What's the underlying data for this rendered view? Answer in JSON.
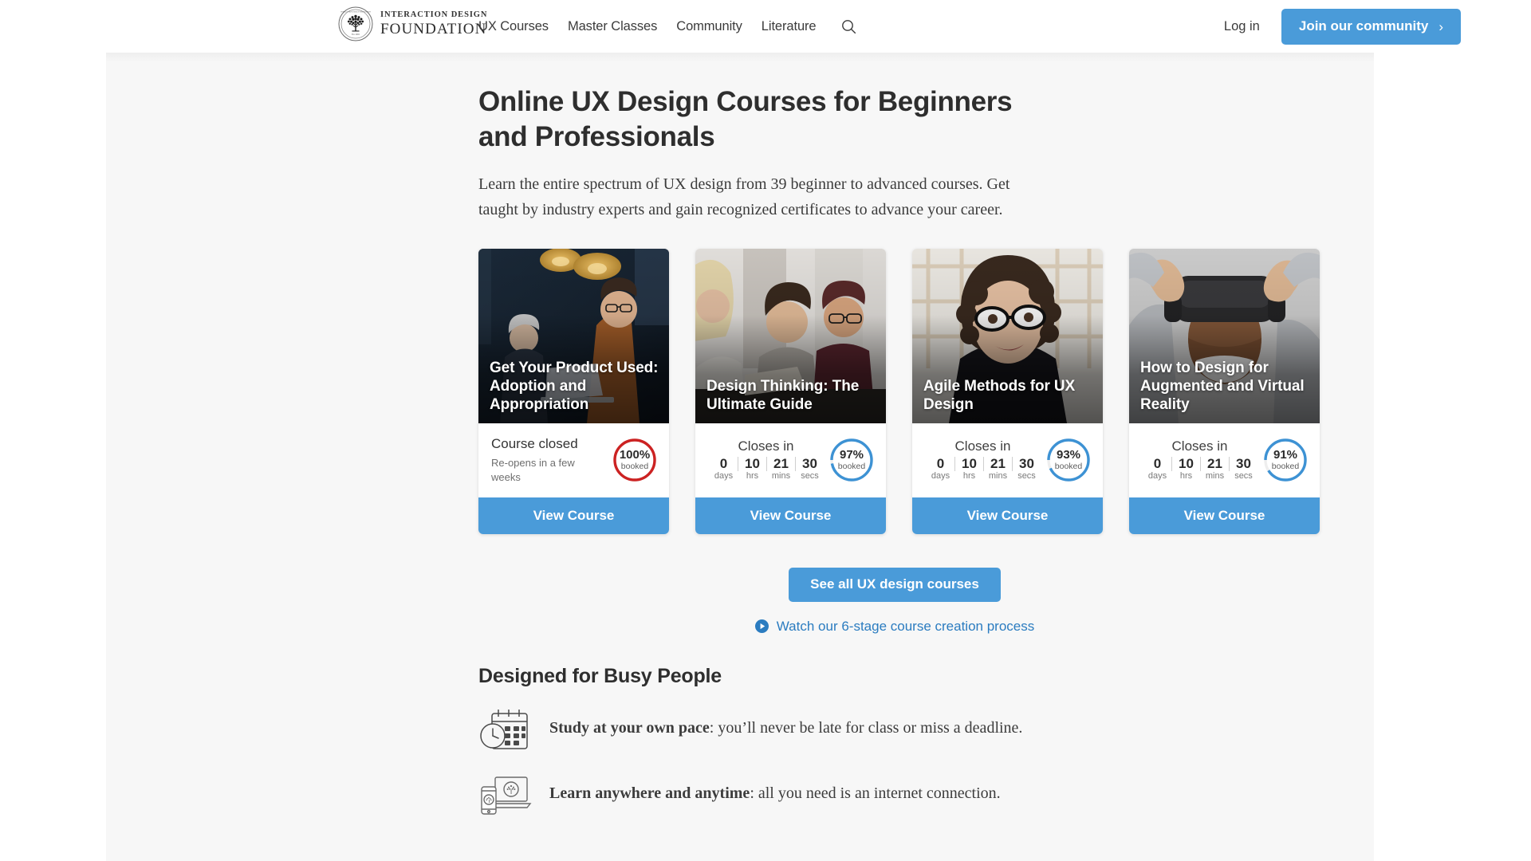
{
  "brand": {
    "line1": "INTERACTION DESIGN",
    "line2": "FOUNDATION",
    "seal_text": "Est. 2002"
  },
  "nav": {
    "items": [
      {
        "label": "UX Courses"
      },
      {
        "label": "Master Classes"
      },
      {
        "label": "Community"
      },
      {
        "label": "Literature"
      }
    ],
    "search_icon": "search-icon",
    "login_label": "Log in",
    "join_label": "Join our community",
    "join_chevron": "›"
  },
  "hero": {
    "title": "Online UX Design Courses for Beginners and Professionals",
    "subtitle": "Learn the entire spectrum of UX design from 39 beginner to advanced courses. Get taught by industry experts and gain recognized certificates to advance your career."
  },
  "cards": [
    {
      "title": "Get Your Product Used: Adoption and Appropriation",
      "state": "closed",
      "closed_head": "Course closed",
      "closed_sub": "Re-opens in a few weeks",
      "percent": 100,
      "percent_label": "100%",
      "booked_label": "booked",
      "ring_color": "#cc2222",
      "cta": "View Course"
    },
    {
      "title": "Design Thinking: The Ultimate Guide",
      "state": "open",
      "closes_label": "Closes in",
      "timer": [
        {
          "value": "0",
          "unit": "days"
        },
        {
          "value": "10",
          "unit": "hrs"
        },
        {
          "value": "21",
          "unit": "mins"
        },
        {
          "value": "30",
          "unit": "secs"
        }
      ],
      "percent": 97,
      "percent_label": "97%",
      "booked_label": "booked",
      "ring_color": "#3d92d4",
      "cta": "View Course"
    },
    {
      "title": "Agile Methods for UX Design",
      "state": "open",
      "closes_label": "Closes in",
      "timer": [
        {
          "value": "0",
          "unit": "days"
        },
        {
          "value": "10",
          "unit": "hrs"
        },
        {
          "value": "21",
          "unit": "mins"
        },
        {
          "value": "30",
          "unit": "secs"
        }
      ],
      "percent": 93,
      "percent_label": "93%",
      "booked_label": "booked",
      "ring_color": "#3d92d4",
      "cta": "View Course"
    },
    {
      "title": "How to Design for Augmented and Virtual Reality",
      "state": "open",
      "closes_label": "Closes in",
      "timer": [
        {
          "value": "0",
          "unit": "days"
        },
        {
          "value": "10",
          "unit": "hrs"
        },
        {
          "value": "21",
          "unit": "mins"
        },
        {
          "value": "30",
          "unit": "secs"
        }
      ],
      "percent": 91,
      "percent_label": "91%",
      "booked_label": "booked",
      "ring_color": "#3d92d4",
      "cta": "View Course"
    }
  ],
  "cta": {
    "see_all_label": "See all UX design courses",
    "watch_label": "Watch our 6-stage course creation process",
    "play_icon": "play-circle-icon"
  },
  "busy": {
    "title": "Designed for Busy People",
    "features": [
      {
        "icon": "calendar-clock-icon",
        "lead": "Study at your own pace",
        "rest": ": you’ll never be late for class or miss a deadline."
      },
      {
        "icon": "laptop-phone-icon",
        "lead": "Learn anywhere and anytime",
        "rest": ": all you need is an internet connection."
      }
    ]
  },
  "colors": {
    "accent_blue": "#4a9bd9",
    "link_blue": "#2b7cc0",
    "closed_red": "#cc2222",
    "panel_bg": "#f7f7f7",
    "text_dark": "#2e2e2e"
  }
}
